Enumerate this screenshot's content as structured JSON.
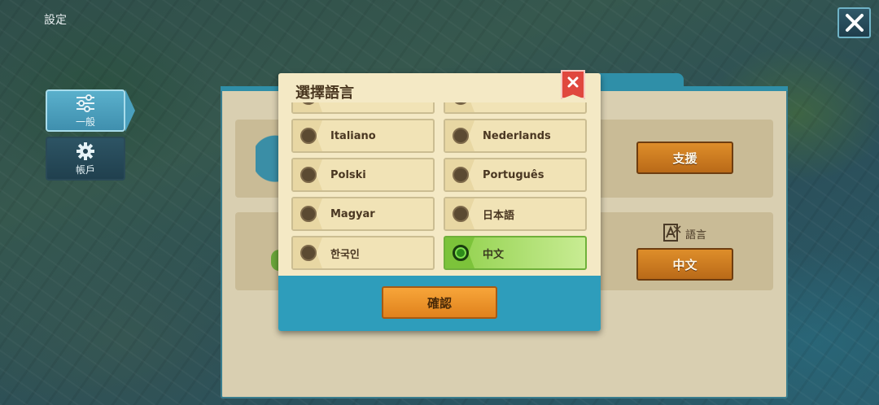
{
  "screen": {
    "title": "設定"
  },
  "sidebar": {
    "items": [
      {
        "label": "一般",
        "icon": "sliders-icon",
        "active": true
      },
      {
        "label": "帳戶",
        "icon": "gear-icon",
        "active": false
      }
    ]
  },
  "settings": {
    "support_label": "支援",
    "language_label": "語言",
    "language_value": "中文"
  },
  "language_modal": {
    "title": "選擇語言",
    "confirm_label": "確認",
    "languages": [
      {
        "label": "",
        "selected": false
      },
      {
        "label": "",
        "selected": false
      },
      {
        "label": "Italiano",
        "selected": false
      },
      {
        "label": "Nederlands",
        "selected": false
      },
      {
        "label": "Polski",
        "selected": false
      },
      {
        "label": "Português",
        "selected": false
      },
      {
        "label": "Magyar",
        "selected": false
      },
      {
        "label": "日本語",
        "selected": false
      },
      {
        "label": "한국인",
        "selected": false
      },
      {
        "label": "中文",
        "selected": true
      }
    ]
  },
  "colors": {
    "accent_blue": "#2e9dbb",
    "selected_green": "#8fd04a",
    "button_orange": "#de8e2a"
  }
}
